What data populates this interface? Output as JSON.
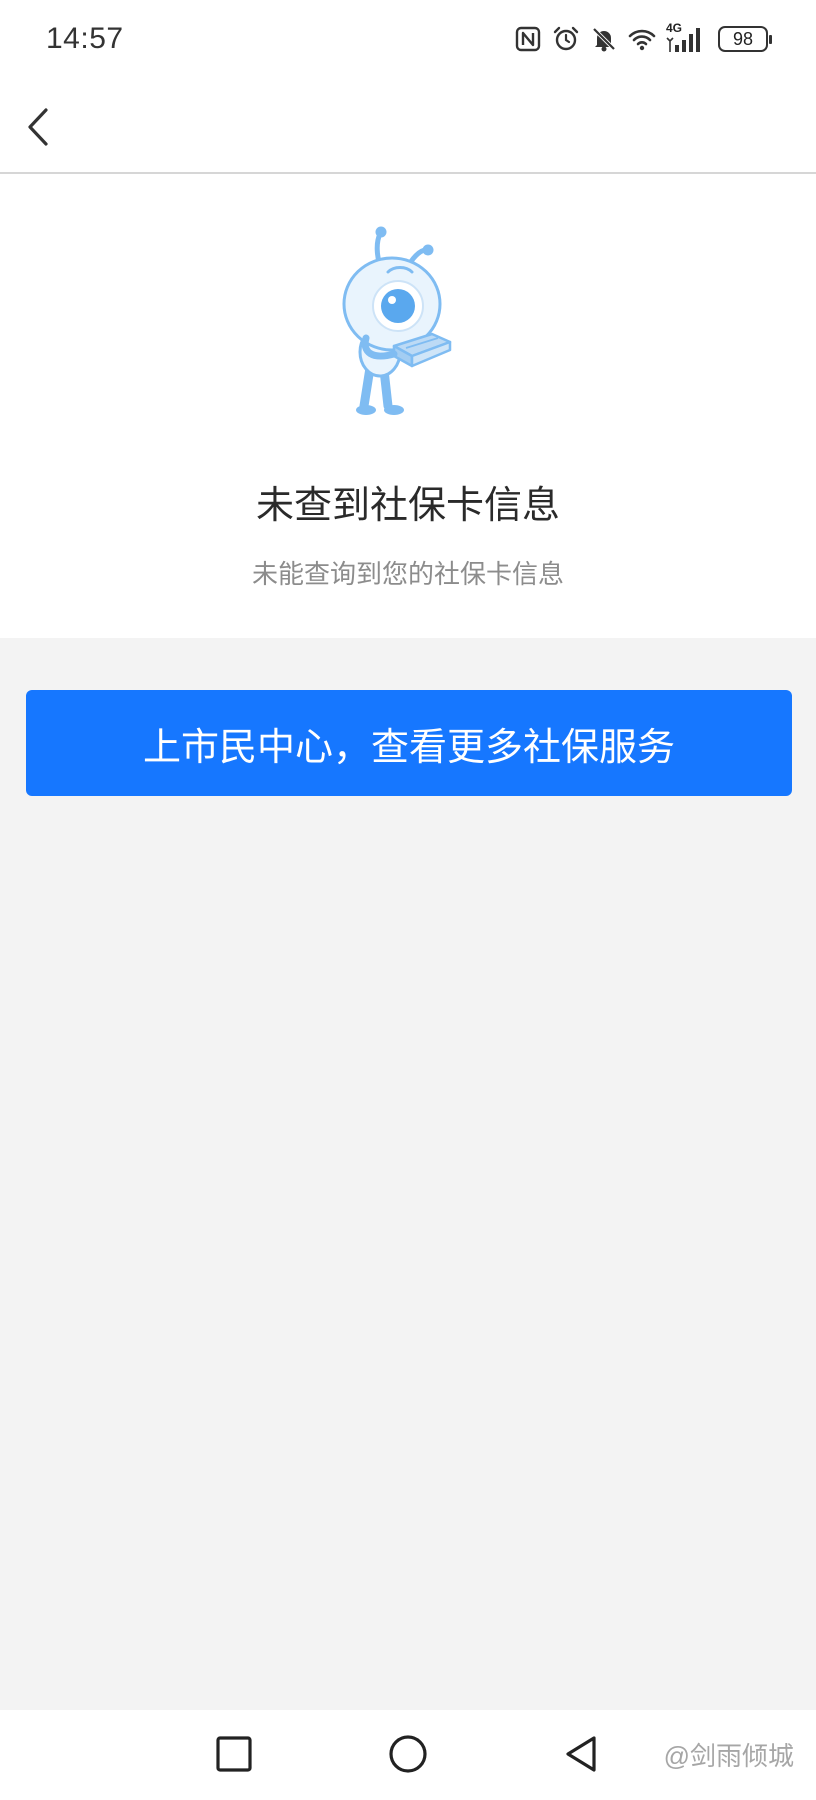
{
  "status_bar": {
    "time": "14:57",
    "network_label": "4G",
    "battery_level": "98",
    "icons": [
      "nfc-icon",
      "alarm-icon",
      "mute-icon",
      "wifi-icon",
      "signal-icon",
      "battery-icon"
    ]
  },
  "nav": {
    "back_icon": "chevron-left-icon"
  },
  "empty_state": {
    "illustration": "ant-mascot-with-book",
    "title": "未查到社保卡信息",
    "subtitle": "未能查询到您的社保卡信息"
  },
  "cta": {
    "label": "上市民中心，查看更多社保服务"
  },
  "system_nav": {
    "icons": [
      "recents-square-icon",
      "home-circle-icon",
      "back-triangle-icon"
    ],
    "watermark": "@剑雨倾城"
  },
  "colors": {
    "primary": "#1677ff",
    "page_background": "#f3f3f3",
    "card_background": "#ffffff",
    "title_text": "#2a2a2a",
    "subtitle_text": "#8c8c8c",
    "mascot_blue": "#7fbcf2"
  }
}
